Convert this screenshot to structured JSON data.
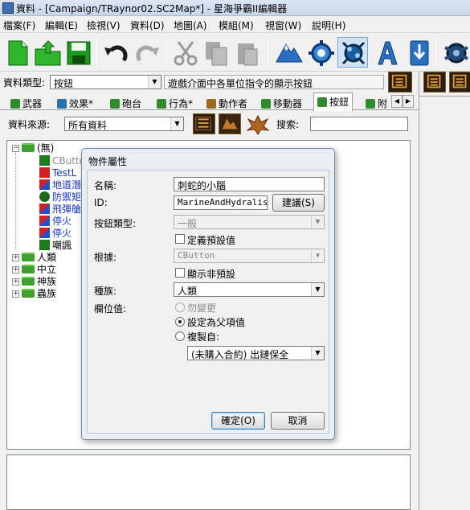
{
  "window": {
    "title": "資料 - [Campaign/TRaynor02.SC2Map*] - 星海爭霸II編輯器"
  },
  "menu": [
    "檔案(F)",
    "編輯(E)",
    "檢視(V)",
    "資料(D)",
    "地圖(A)",
    "模組(M)",
    "視窗(W)",
    "說明(H)"
  ],
  "toolbar": {
    "icons": [
      "new-document-icon",
      "open-folder-icon",
      "save-disk-icon",
      "undo-icon",
      "redo-icon",
      "cut-scissors-icon",
      "copy-icon",
      "paste-icon",
      "terrain-editor-icon",
      "trigger-editor-icon",
      "data-editor-icon",
      "text-editor-icon",
      "import-icon",
      "unit-editor-icon"
    ]
  },
  "data_type": {
    "label": "資料類型:",
    "value": "按鈕",
    "description": "遊戲介面中各單位指令的顯示按鈕"
  },
  "tabs": [
    {
      "label": "武器",
      "color": "#2e8b2e"
    },
    {
      "label": "效果*",
      "color": "#2a6fb0"
    },
    {
      "label": "砲台",
      "color": "#2e8b2e"
    },
    {
      "label": "行為*",
      "color": "#2e8b2e"
    },
    {
      "label": "動作者",
      "color": "#9b6a1a"
    },
    {
      "label": "移動器",
      "color": "#2e8b2e"
    },
    {
      "label": "按鈕",
      "color": "#2e8b2e"
    },
    {
      "label": "附",
      "color": "#2e8b2e"
    }
  ],
  "source": {
    "label": "資料來源:",
    "value": "所有資料",
    "search_label": "搜索:",
    "search_value": ""
  },
  "tree": {
    "root": "(無)",
    "children": [
      "CButton",
      "TestL",
      "地道潛",
      "防禦矩",
      "飛彈艙",
      "停火",
      "停火",
      "嘲諷"
    ],
    "groups": [
      "人類",
      "中立",
      "神族",
      "蟲族"
    ]
  },
  "dialog": {
    "title": "物件屬性",
    "name_label": "名稱:",
    "name_value": "刺蛇的小腦",
    "id_label": "ID:",
    "id_value": "MarineAndHydralisk",
    "suggest_button": "建議(S)",
    "button_type_label": "按鈕類型:",
    "button_type_value": "一般",
    "define_default": "定義預設值",
    "base_label": "根據:",
    "base_value": "CButton",
    "show_non_default": "顯示非預設",
    "race_label": "種族:",
    "race_value": "人類",
    "field_label": "欄位值:",
    "opt_no_change": "勿變更",
    "opt_set_parent": "設定為父項值",
    "opt_copy_from": "複製自:",
    "copy_from_value": "(未購入合約) 出鏈保全",
    "ok_button": "確定(O)",
    "cancel_button": "取消"
  }
}
